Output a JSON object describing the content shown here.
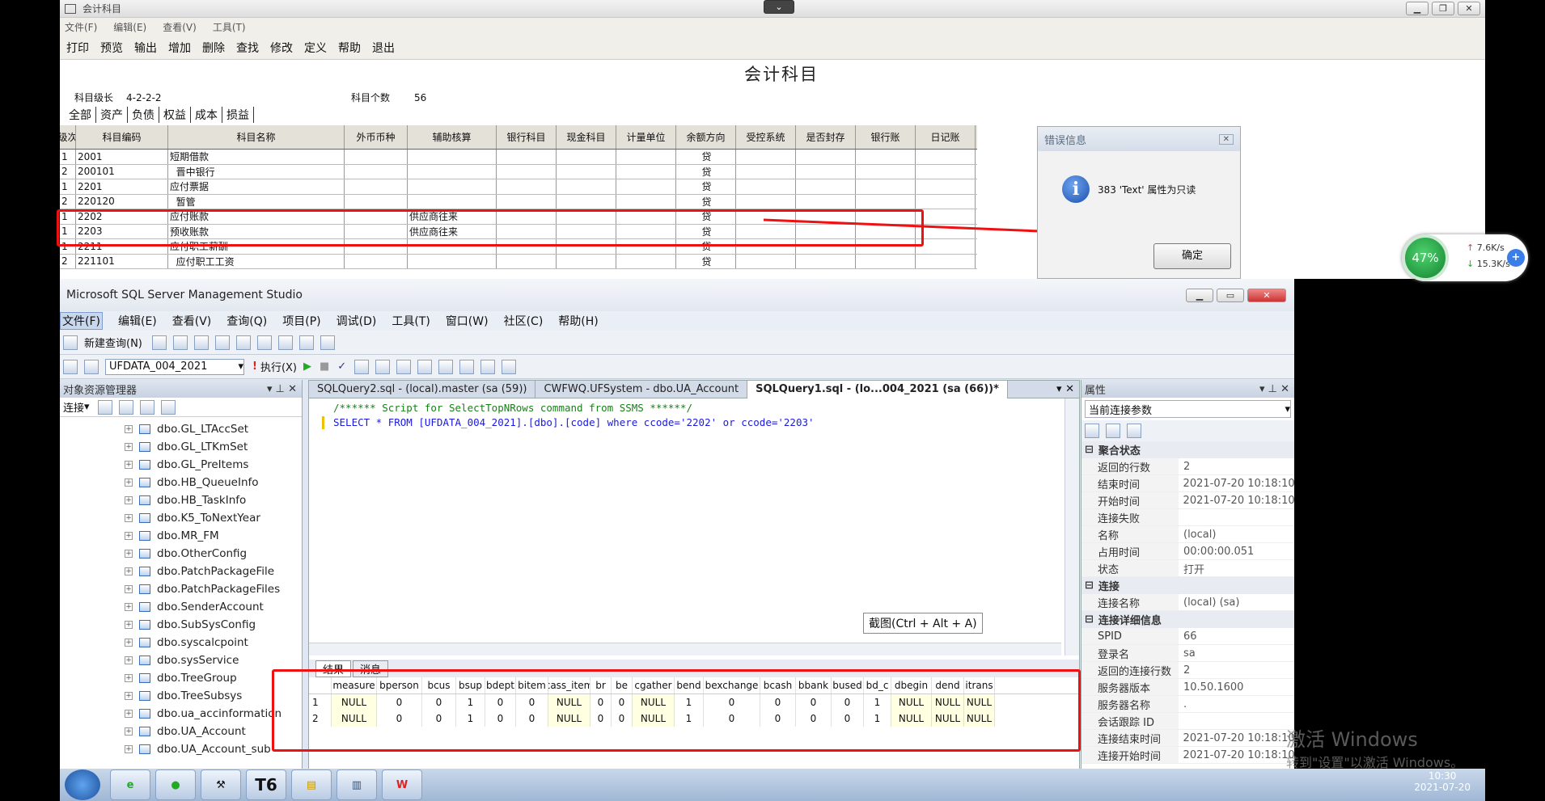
{
  "acct": {
    "title": "会计科目",
    "menu": [
      "文件(F)",
      "编辑(E)",
      "查看(V)",
      "工具(T)"
    ],
    "toolbar": [
      "打印",
      "预览",
      "输出",
      "增加",
      "删除",
      "查找",
      "修改",
      "定义",
      "帮助",
      "退出"
    ],
    "report_title": "会计科目",
    "level_label": "科目级长",
    "level_value": "4-2-2-2",
    "count_label": "科目个数",
    "count_value": "56",
    "tabs": [
      "全部",
      "资产",
      "负债",
      "权益",
      "成本",
      "损益"
    ],
    "grid_headers": [
      "级次",
      "科目编码",
      "科目名称",
      "外币币种",
      "辅助核算",
      "银行科目",
      "现金科目",
      "计量单位",
      "余额方向",
      "受控系统",
      "是否封存",
      "银行账",
      "日记账"
    ],
    "rows": [
      {
        "lvl": "1",
        "code": "2001",
        "name": "短期借款",
        "aux": "",
        "dir": "贷"
      },
      {
        "lvl": "2",
        "code": "200101",
        "name": "  晋中银行",
        "aux": "",
        "dir": "贷"
      },
      {
        "lvl": "1",
        "code": "2201",
        "name": "应付票据",
        "aux": "",
        "dir": "贷"
      },
      {
        "lvl": "2",
        "code": "220120",
        "name": "  暂管",
        "aux": "",
        "dir": "贷"
      },
      {
        "lvl": "1",
        "code": "2202",
        "name": "应付账款",
        "aux": "供应商往来",
        "dir": "贷"
      },
      {
        "lvl": "1",
        "code": "2203",
        "name": "预收账款",
        "aux": "供应商往来",
        "dir": "贷"
      },
      {
        "lvl": "1",
        "code": "2211",
        "name": "应付职工薪酬",
        "aux": "",
        "dir": "贷"
      },
      {
        "lvl": "2",
        "code": "221101",
        "name": "  应付职工工资",
        "aux": "",
        "dir": "贷"
      }
    ]
  },
  "error_dialog": {
    "title": "错误信息",
    "message": "383 'Text' 属性为只读",
    "ok": "确定"
  },
  "net": {
    "percent": "47%",
    "up": "7.6K/s",
    "down": "15.3K/s"
  },
  "ssms": {
    "title": "Microsoft SQL Server Management Studio",
    "menu": [
      "文件(F)",
      "编辑(E)",
      "查看(V)",
      "查询(Q)",
      "项目(P)",
      "调试(D)",
      "工具(T)",
      "窗口(W)",
      "社区(C)",
      "帮助(H)"
    ],
    "new_query": "新建查询(N)",
    "database": "UFDATA_004_2021",
    "execute": "执行(X)",
    "oe_title": "对象资源管理器",
    "oe_connect": "连接",
    "oe_items": [
      "dbo.GL_LTAccSet",
      "dbo.GL_LTKmSet",
      "dbo.GL_PreItems",
      "dbo.HB_QueueInfo",
      "dbo.HB_TaskInfo",
      "dbo.K5_ToNextYear",
      "dbo.MR_FM",
      "dbo.OtherConfig",
      "dbo.PatchPackageFile",
      "dbo.PatchPackageFiles",
      "dbo.SenderAccount",
      "dbo.SubSysConfig",
      "dbo.syscalcpoint",
      "dbo.sysService",
      "dbo.TreeGroup",
      "dbo.TreeSubsys",
      "dbo.ua_accinformation",
      "dbo.UA_Account",
      "dbo.UA_Account_sub"
    ],
    "tabs": [
      "SQLQuery2.sql - (local).master (sa (59))",
      "CWFWQ.UFSystem - dbo.UA_Account",
      "SQLQuery1.sql - (lo...004_2021 (sa (66))*"
    ],
    "code_line1": "/****** Script for SelectTopNRows command from SSMS  ******/",
    "code_line2": "SELECT * FROM [UFDATA_004_2021].[dbo].[code] where ccode='2202' or ccode='2203'",
    "tooltip": "截图(Ctrl + Alt + A)",
    "results_tab": "结果",
    "messages_tab": "消息",
    "result_headers": [
      "measure",
      "bperson",
      "bcus",
      "bsup",
      "bdept",
      "bitem",
      "cass_item",
      "br",
      "be",
      "cgather",
      "bend",
      "bexchange",
      "bcash",
      "bbank",
      "bused",
      "bd_c",
      "dbegin",
      "dend",
      "itrans"
    ],
    "result_rows": [
      [
        "1",
        "NULL",
        "0",
        "0",
        "1",
        "0",
        "0",
        "NULL",
        "0",
        "0",
        "NULL",
        "1",
        "0",
        "0",
        "0",
        "0",
        "1",
        "NULL",
        "NULL",
        "NULL"
      ],
      [
        "2",
        "NULL",
        "0",
        "0",
        "1",
        "0",
        "0",
        "NULL",
        "0",
        "0",
        "NULL",
        "1",
        "0",
        "0",
        "0",
        "0",
        "1",
        "NULL",
        "NULL",
        "NULL"
      ]
    ],
    "props_title": "属性",
    "props_dropdown": "当前连接参数",
    "props": [
      {
        "cat": "聚合状态"
      },
      {
        "k": "返回的行数",
        "v": "2"
      },
      {
        "k": "结束时间",
        "v": "2021-07-20 10:18:10"
      },
      {
        "k": "开始时间",
        "v": "2021-07-20 10:18:10"
      },
      {
        "k": "连接失败",
        "v": ""
      },
      {
        "k": "名称",
        "v": "(local)"
      },
      {
        "k": "占用时间",
        "v": "00:00:00.051"
      },
      {
        "k": "状态",
        "v": "打开"
      },
      {
        "cat": "连接"
      },
      {
        "k": "连接名称",
        "v": "(local) (sa)"
      },
      {
        "cat": "连接详细信息"
      },
      {
        "k": "SPID",
        "v": "66"
      },
      {
        "k": "登录名",
        "v": "sa"
      },
      {
        "k": "返回的连接行数",
        "v": "2"
      },
      {
        "k": "服务器版本",
        "v": "10.50.1600"
      },
      {
        "k": "服务器名称",
        "v": "."
      },
      {
        "k": "会话跟踪 ID",
        "v": ""
      },
      {
        "k": "连接结束时间",
        "v": "2021-07-20 10:18:10"
      },
      {
        "k": "连接开始时间",
        "v": "2021-07-20 10:18:10"
      }
    ]
  },
  "watermark": {
    "line1": "激活 Windows",
    "line2": "转到\"设置\"以激活 Windows。"
  },
  "taskbar": {
    "apps": [
      "T6"
    ],
    "time": "10:30",
    "date": "2021-07-20"
  },
  "colors": {
    "annotation": "#e11111",
    "ssms_bg": "#dfe7f3"
  }
}
